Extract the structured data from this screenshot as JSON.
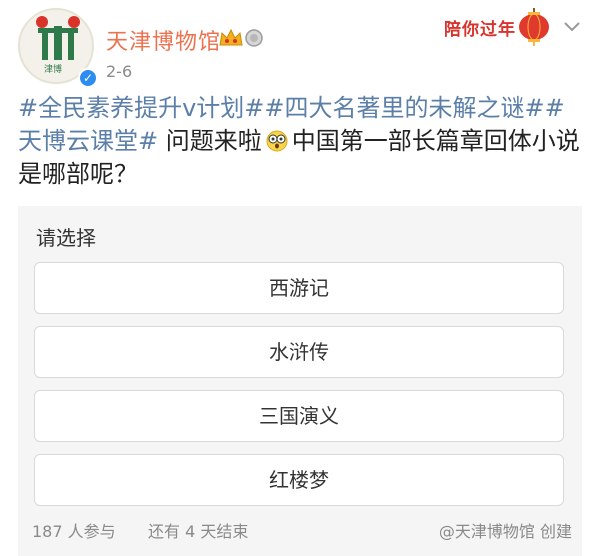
{
  "post": {
    "author": "天津博物馆",
    "date": "2-6",
    "festival_badge": "陪你过年",
    "text": {
      "topics": [
        "#全民素养提升v计划#",
        "#四大名著里的未解之谜#",
        "#天博云课堂#"
      ],
      "before_emoji": " 问题来啦",
      "after_emoji": "中国第一部长篇章回体小说是哪部呢？"
    }
  },
  "vote": {
    "title": "请选择",
    "options": [
      "西游记",
      "水浒传",
      "三国演义",
      "红楼梦"
    ],
    "participants": "187 人参与",
    "remaining": "还有 4 天结束",
    "creator": "@天津博物馆 创建"
  },
  "colors": {
    "author": "#eb7350",
    "topic": "#5b7fa8",
    "festival": "#d9332b",
    "verified": "#2d8cf0"
  },
  "icons": [
    "avatar-logo",
    "verified-icon",
    "crown-badge-icon",
    "medal-badge-icon",
    "lantern-icon",
    "chevron-down-icon",
    "shocked-emoji-icon"
  ]
}
